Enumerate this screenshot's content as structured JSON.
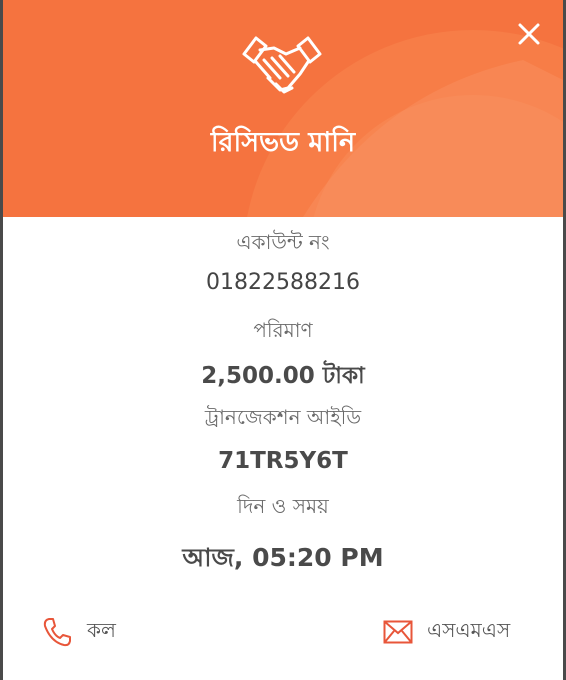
{
  "header": {
    "title": "রিসিভড মানি",
    "icon": "handshake-icon",
    "close_icon": "close-icon",
    "bg_color": "#f5733f"
  },
  "details": {
    "account_label": "একাউন্ট নং",
    "account_value": "01822588216",
    "amount_label": "পরিমাণ",
    "amount_value": "2,500.00 টাকা",
    "txn_label": "ট্রানজেকশন আইডি",
    "txn_value": "71TR5Y6T",
    "datetime_label": "দিন ও সময়",
    "datetime_value": "আজ, 05:20 PM"
  },
  "actions": {
    "call_label": "কল",
    "call_icon": "phone-icon",
    "sms_label": "এসএমএস",
    "sms_icon": "envelope-icon",
    "icon_color": "#e8563a"
  }
}
